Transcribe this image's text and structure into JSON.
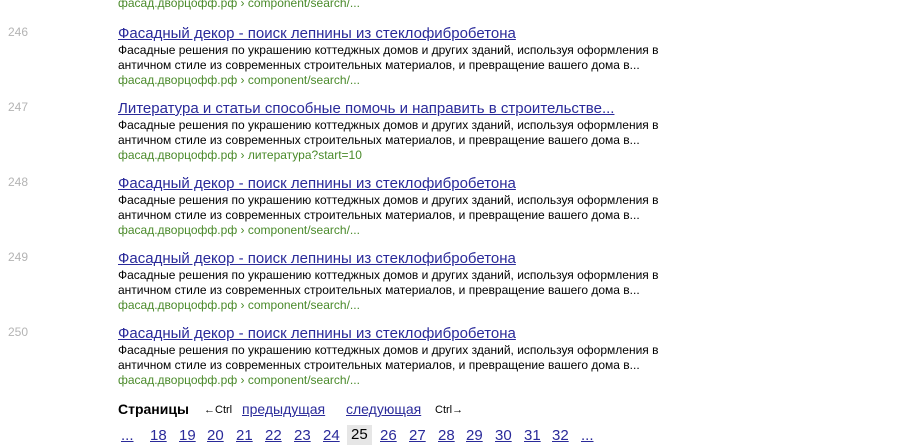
{
  "top_url": "фасад.дворцофф.рф › component/search/...",
  "results": [
    {
      "num": "246",
      "title": "Фасадный декор - поиск лепнины из стеклофибробетона",
      "snippet_line1": "Фасадные решения по украшению коттеджных домов и других зданий, используя оформления в",
      "snippet_line2": "античном стиле из современных строительных материалов, и превращение вашего дома в...",
      "url": "фасад.дворцофф.рф › component/search/..."
    },
    {
      "num": "247",
      "title": "Литература и статьи способные помочь и направить в строительстве...",
      "snippet_line1": "Фасадные решения по украшению коттеджных домов и других зданий, используя оформления в",
      "snippet_line2": "античном стиле из современных строительных материалов, и превращение вашего дома в...",
      "url": "фасад.дворцофф.рф › литература?start=10"
    },
    {
      "num": "248",
      "title": "Фасадный декор - поиск лепнины из стеклофибробетона",
      "snippet_line1": "Фасадные решения по украшению коттеджных домов и других зданий, используя оформления в",
      "snippet_line2": "античном стиле из современных строительных материалов, и превращение вашего дома в...",
      "url": "фасад.дворцофф.рф › component/search/..."
    },
    {
      "num": "249",
      "title": "Фасадный декор - поиск лепнины из стеклофибробетона",
      "snippet_line1": "Фасадные решения по украшению коттеджных домов и других зданий, используя оформления в",
      "snippet_line2": "античном стиле из современных строительных материалов, и превращение вашего дома в...",
      "url": "фасад.дворцофф.рф › component/search/..."
    },
    {
      "num": "250",
      "title": "Фасадный декор - поиск лепнины из стеклофибробетона",
      "snippet_line1": "Фасадные решения по украшению коттеджных домов и других зданий, используя оформления в",
      "snippet_line2": "античном стиле из современных строительных материалов, и превращение вашего дома в...",
      "url": "фасад.дворцофф.рф › component/search/..."
    }
  ],
  "pager": {
    "label": "Страницы",
    "ctrl_left": "←Ctrl",
    "prev": "предыдущая",
    "next": "следующая",
    "ctrl_right": "Ctrl→",
    "pages": [
      "...",
      "18",
      "19",
      "20",
      "21",
      "22",
      "23",
      "24",
      "25",
      "26",
      "27",
      "28",
      "29",
      "30",
      "31",
      "32",
      "..."
    ],
    "current": "25"
  },
  "colors": {
    "link": "#2a2a9a",
    "url_green": "#4a8a2a",
    "result_number": "#b4b4b4",
    "current_page_bg": "#e6e6e6"
  }
}
